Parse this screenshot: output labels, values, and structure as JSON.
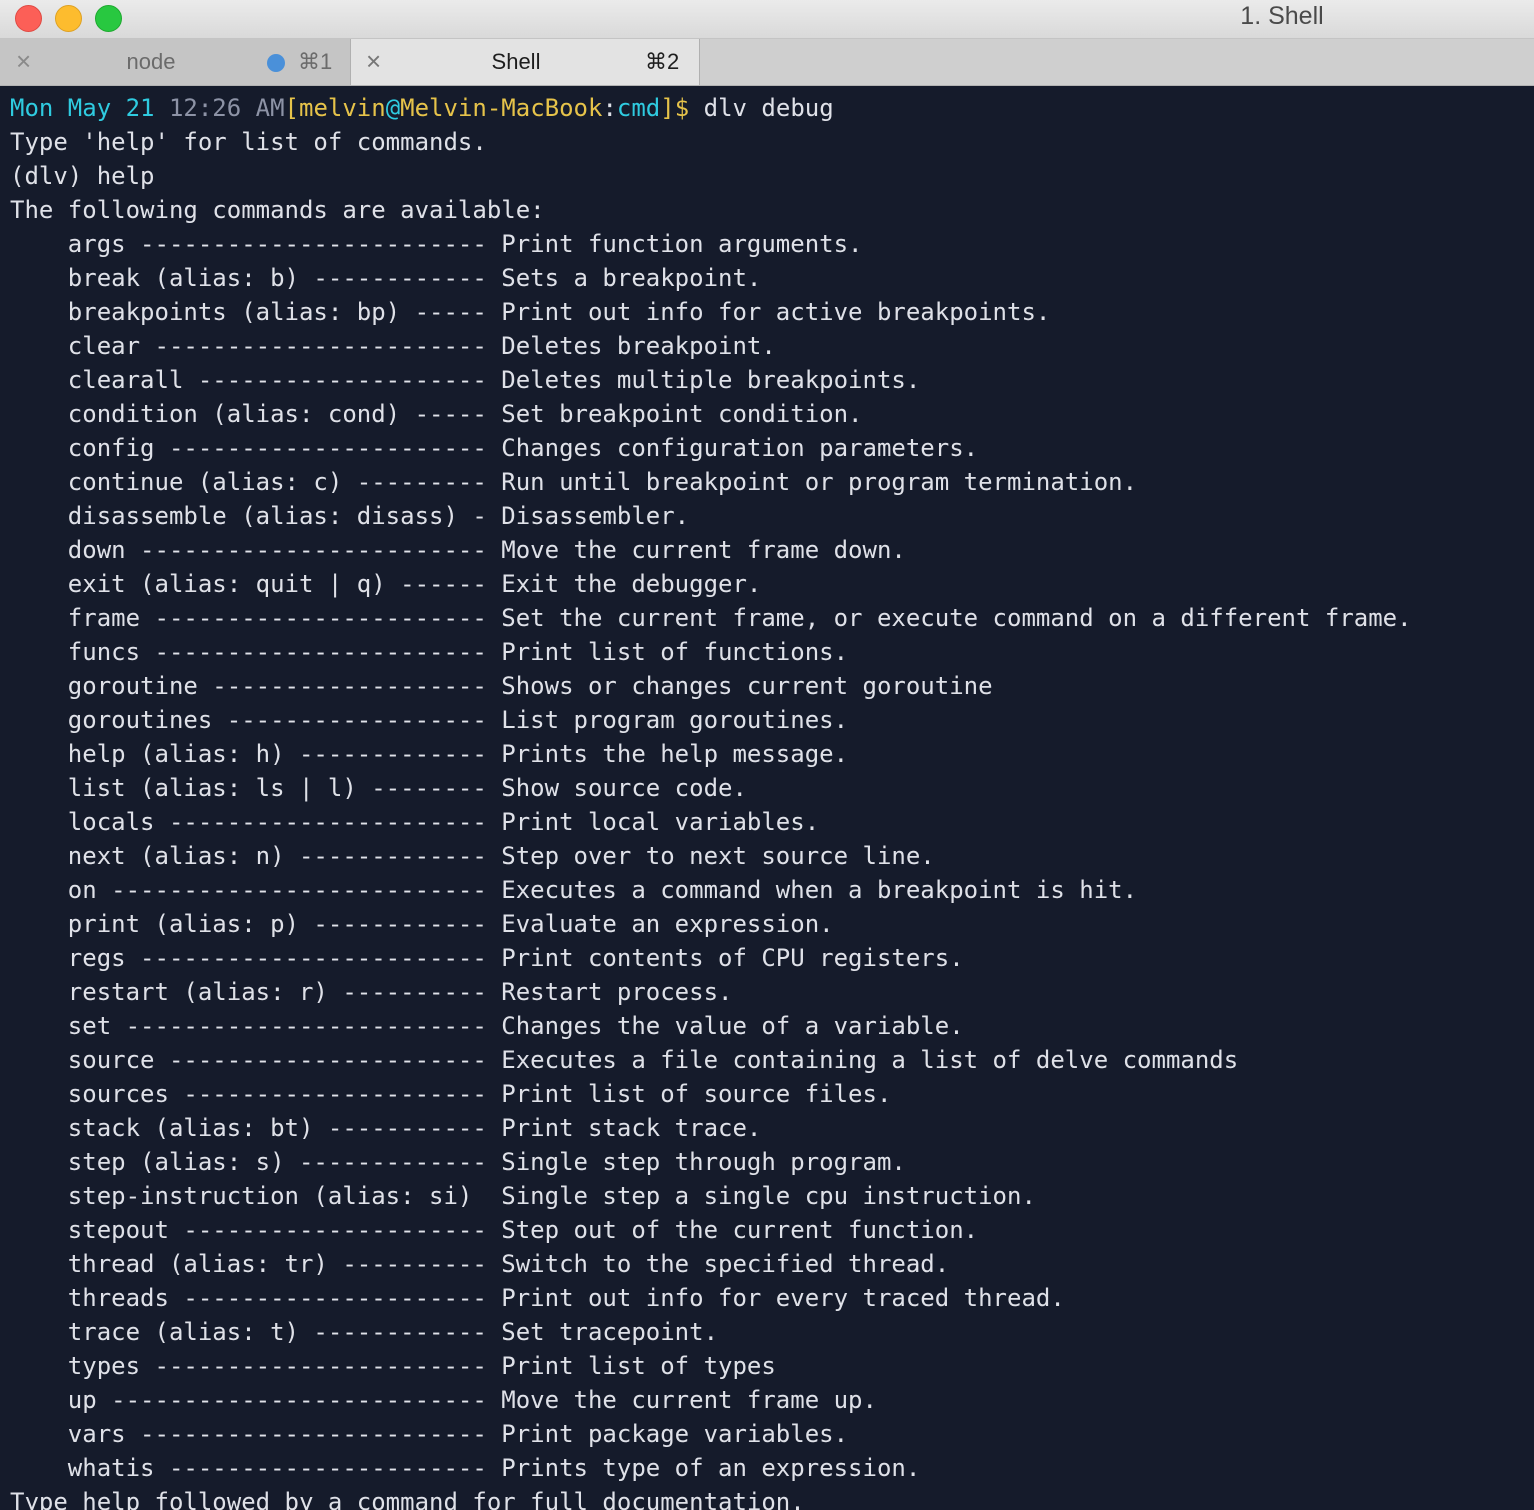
{
  "window": {
    "title": "1. Shell"
  },
  "tabs": [
    {
      "label": "node",
      "shortcut": "⌘1",
      "close_glyph": "×",
      "active": false
    },
    {
      "label": "Shell",
      "shortcut": "⌘2",
      "close_glyph": "×",
      "active": true
    }
  ],
  "prompt": {
    "date": "Mon May 21",
    "time": "12:26 AM",
    "open_bracket": "[",
    "user": "melvin",
    "at": "@",
    "host": "Melvin-MacBook",
    "colon": ":",
    "dir": "cmd",
    "close": "]$",
    "command": "dlv debug"
  },
  "lines": [
    "Type 'help' for list of commands.",
    "(dlv) help",
    "The following commands are available:",
    "    args ------------------------ Print function arguments.",
    "    break (alias: b) ------------ Sets a breakpoint.",
    "    breakpoints (alias: bp) ----- Print out info for active breakpoints.",
    "    clear ----------------------- Deletes breakpoint.",
    "    clearall -------------------- Deletes multiple breakpoints.",
    "    condition (alias: cond) ----- Set breakpoint condition.",
    "    config ---------------------- Changes configuration parameters.",
    "    continue (alias: c) --------- Run until breakpoint or program termination.",
    "    disassemble (alias: disass) - Disassembler.",
    "    down ------------------------ Move the current frame down.",
    "    exit (alias: quit | q) ------ Exit the debugger.",
    "    frame ----------------------- Set the current frame, or execute command on a different frame.",
    "    funcs ----------------------- Print list of functions.",
    "    goroutine ------------------- Shows or changes current goroutine",
    "    goroutines ------------------ List program goroutines.",
    "    help (alias: h) ------------- Prints the help message.",
    "    list (alias: ls | l) -------- Show source code.",
    "    locals ---------------------- Print local variables.",
    "    next (alias: n) ------------- Step over to next source line.",
    "    on -------------------------- Executes a command when a breakpoint is hit.",
    "    print (alias: p) ------------ Evaluate an expression.",
    "    regs ------------------------ Print contents of CPU registers.",
    "    restart (alias: r) ---------- Restart process.",
    "    set ------------------------- Changes the value of a variable.",
    "    source ---------------------- Executes a file containing a list of delve commands",
    "    sources --------------------- Print list of source files.",
    "    stack (alias: bt) ----------- Print stack trace.",
    "    step (alias: s) ------------- Single step through program.",
    "    step-instruction (alias: si)  Single step a single cpu instruction.",
    "    stepout --------------------- Step out of the current function.",
    "    thread (alias: tr) ---------- Switch to the specified thread.",
    "    threads --------------------- Print out info for every traced thread.",
    "    trace (alias: t) ------------ Set tracepoint.",
    "    types ----------------------- Print list of types",
    "    up -------------------------- Move the current frame up.",
    "    vars ------------------------ Print package variables.",
    "    whatis ---------------------- Prints type of an expression.",
    "Type help followed by a command for full documentation."
  ]
}
